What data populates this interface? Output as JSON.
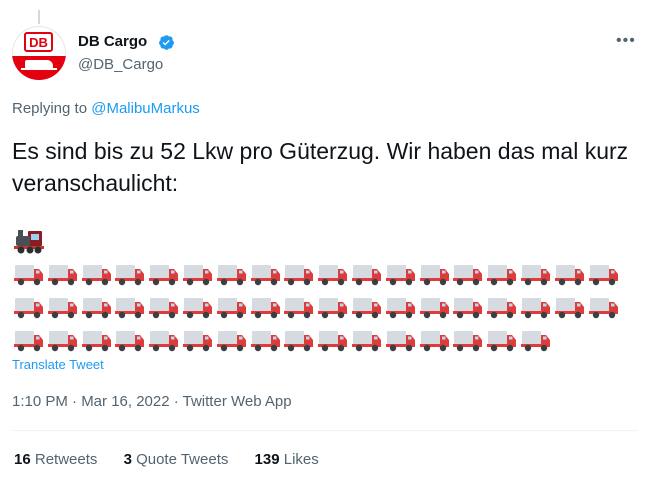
{
  "account": {
    "name": "DB Cargo",
    "handle": "@DB_Cargo",
    "logo_text": "DB",
    "brand_color": "#e3000f",
    "verified_color": "#1d9bf0"
  },
  "more_icon": "more-options-icon",
  "reply_prefix": "Replying to",
  "reply_to": "@MalibuMarkus",
  "tweet_text": "Es sind bis zu 52 Lkw pro Güterzug. Wir haben das mal kurz veranschaulicht:",
  "emoji": {
    "train": "🚂",
    "truck": "🚚",
    "truck_count": 52,
    "trucks_per_row": 18
  },
  "translate_label": "Translate Tweet",
  "meta": "1:10 PM · Mar 16, 2022 · Twitter Web App",
  "stats": {
    "retweets_count": "16",
    "retweets_label": "Retweets",
    "quotes_count": "3",
    "quotes_label": "Quote Tweets",
    "likes_count": "139",
    "likes_label": "Likes"
  }
}
